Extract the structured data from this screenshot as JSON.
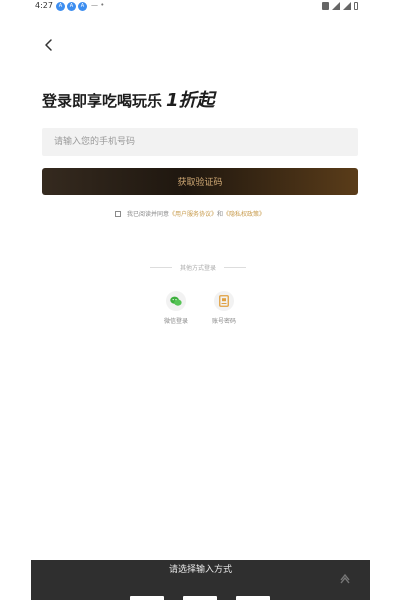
{
  "status_bar": {
    "time": "4:27",
    "notification_icons": [
      "A",
      "A",
      "A"
    ],
    "extra": "— •"
  },
  "header": {
    "back_icon": "chevron-left-icon",
    "title": "登录即享吃喝玩乐",
    "title_accent": "1折起",
    "accent_color": "#1e1e1e"
  },
  "form": {
    "phone_placeholder": "请输入您的手机号码",
    "phone_value": "",
    "get_code_label": "获取验证码",
    "button_text_color": "#cfa874",
    "agreement_prefix": "我已阅读并同意",
    "agreement_user": "《用户服务协议》",
    "agreement_and": "和",
    "agreement_privacy": "《隐私权政策》",
    "link_color": "#c79a4a"
  },
  "other_login": {
    "title": "其他方式登录",
    "methods": [
      {
        "label": "微信登录",
        "icon": "wechat-icon",
        "color": "#3fb03f"
      },
      {
        "label": "账号密码",
        "icon": "account-password-icon",
        "color": "#e0a040"
      }
    ]
  },
  "ime_panel": {
    "title": "请选择输入方式",
    "logo_icon": "input-method-logo-icon"
  }
}
